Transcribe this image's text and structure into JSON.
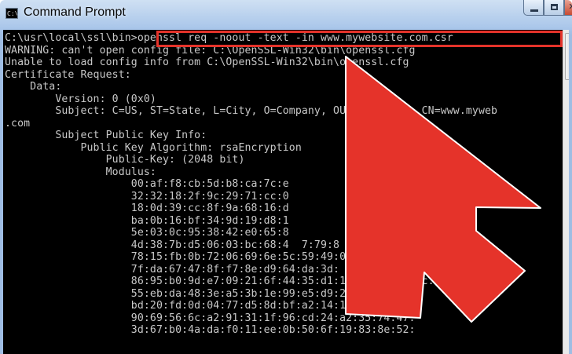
{
  "window": {
    "title": "Command Prompt",
    "icon_label": "C:\\.",
    "controls": {
      "minimize": "minimize",
      "maximize": "maximize",
      "close": "✕"
    }
  },
  "console": {
    "lines": [
      "C:\\usr\\local\\ssl\\bin>openssl req -noout -text -in www.mywebsite.com.csr",
      "WARNING: can't open config file: C:\\OpenSSL-Win32\\bin\\openssl.cfg",
      "Unable to load config info from C:\\OpenSSL-Win32\\bin\\openssl.cfg",
      "Certificate Request:",
      "    Data:",
      "        Version: 0 (0x0)",
      "        Subject: C=US, ST=State, L=City, O=Company, OU=Selection, CN=www.myweb",
      ".com",
      "        Subject Public Key Info:",
      "            Public Key Algorithm: rsaEncryption",
      "                Public-Key: (2048 bit)",
      "                Modulus:",
      "                    00:af:f8:cb:5d:b8:ca:7c:e",
      "                    32:32:18:2f:9c:29:71:cc:0              :2e:18:",
      "                    18:0d:39:cc:8f:9a:68:16:d              48:07:",
      "                    ba:0b:16:bf:34:9d:19:d8:1              :d0:",
      "                    5e:03:0c:95:38:42:e0:65:8         bf:2   :73:",
      "                    4d:38:7b:d5:06:03:bc:68:4  7:79:8        :b8:",
      "                    78:15:fb:0b:72:06:69:6e:5c:59:49:08         :e6:",
      "                    7f:da:67:47:8f:f7:8e:d9:64:da:3d:         :78:",
      "                    86:95:b0:9d:e7:09:21:6f:44:35:d1:1a:c       :9c:",
      "                    55:eb:da:48:3e:a5:3b:1e:99:e5:d9:21:da:04:b9:",
      "                    bd:20:fd:0d:04:77:d5:8d:bf:a2:14:1b:32:6a:e7:",
      "                    90:69:56:6c:a2:91:31:1f:96:cd:24:a2:35:74:47:",
      "                    3d:67:b0:4a:da:f0:11:ee:0b:50:6f:19:83:8e:52:"
    ]
  },
  "annotation": {
    "color": "#e5332a"
  }
}
